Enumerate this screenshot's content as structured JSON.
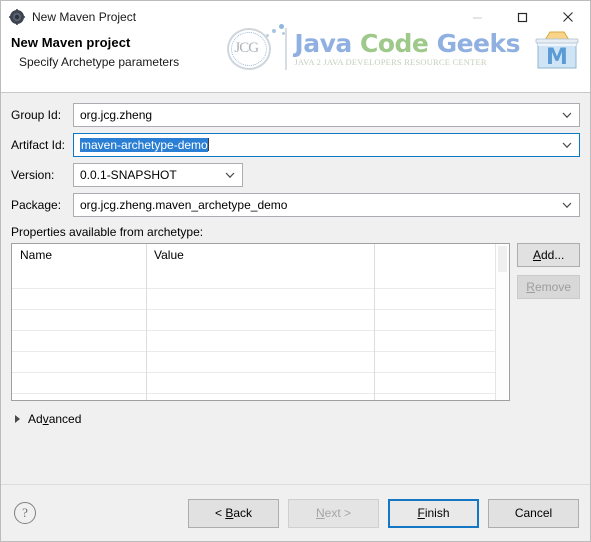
{
  "window": {
    "title": "New Maven Project",
    "title_icon": "maven-gear-icon",
    "minimize_label": "—",
    "maximize_label": "□",
    "close_label": "✕"
  },
  "header": {
    "title": "New Maven project",
    "subtitle": "Specify Archetype parameters",
    "logo": {
      "mark_letters": "JCG",
      "brand_word1": "Java",
      "brand_word2": "Code",
      "brand_word3": "Geeks",
      "tagline": "JAVA 2 JAVA DEVELOPERS RESOURCE CENTER",
      "brand_color_blue": "#8fb0e0",
      "brand_color_green": "#9ec98a",
      "tagline_color": "#c3cfbb",
      "maven_icon_letter": "M"
    }
  },
  "form": {
    "fields": [
      {
        "label": "Group Id:",
        "value": "org.jcg.zheng",
        "selected": false,
        "width": "full"
      },
      {
        "label": "Artifact Id:",
        "value": "maven-archetype-demo",
        "selected": true,
        "width": "full"
      },
      {
        "label": "Version:",
        "value": "0.0.1-SNAPSHOT",
        "selected": false,
        "width": "narrow"
      },
      {
        "label": "Package:",
        "value": "org.jcg.zheng.maven_archetype_demo",
        "selected": false,
        "width": "full"
      }
    ],
    "selection_color": "#2a7fd4"
  },
  "properties": {
    "label": "Properties available from archetype:",
    "columns": [
      "Name",
      "Value",
      ""
    ],
    "rows": [],
    "empty_row_count": 6,
    "add_button": {
      "label": "Add...",
      "mnemonic": "A",
      "enabled": true
    },
    "remove_button": {
      "label": "Remove",
      "mnemonic": "R",
      "enabled": false
    }
  },
  "advanced": {
    "label": "Advanced",
    "mnemonic": "v",
    "expanded": false
  },
  "footer": {
    "help_icon": "question-mark-icon",
    "buttons": [
      {
        "label": "< Back",
        "mnemonic": "B",
        "enabled": true,
        "default": false
      },
      {
        "label": "Next >",
        "mnemonic": "N",
        "enabled": false,
        "default": false
      },
      {
        "label": "Finish",
        "mnemonic": "F",
        "enabled": true,
        "default": true
      },
      {
        "label": "Cancel",
        "mnemonic": "",
        "enabled": true,
        "default": false
      }
    ],
    "default_border_color": "#1577c4"
  }
}
